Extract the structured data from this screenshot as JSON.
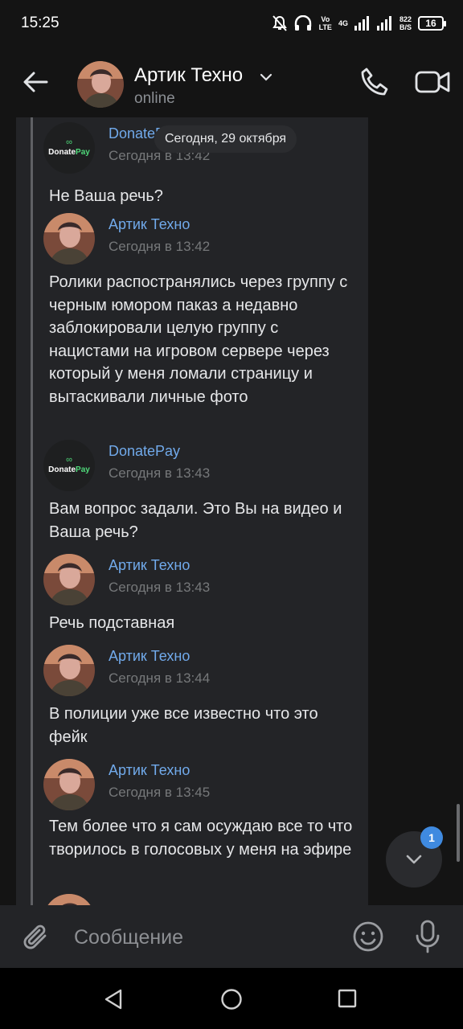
{
  "status_bar": {
    "time": "15:25",
    "volte": "Vo\nLTE",
    "network": "4G",
    "speed_value": "822",
    "speed_unit": "B/S",
    "battery": "16"
  },
  "header": {
    "contact_name": "Артик Техно",
    "contact_status": "online"
  },
  "date_divider": "Сегодня, 29 октября",
  "messages": [
    {
      "author": "DonatePay",
      "time": "Сегодня в 13:42",
      "text": "Не Ваша речь?",
      "avatar": "donatepay-logo"
    },
    {
      "author": "Артик Техно",
      "time": "Сегодня в 13:42",
      "text": "Ролики распостранялись через группу с черным юмором паказ а недавно заблокировали целую группу с нацистами на игровом сервере через который у меня ломали страницу и вытаскивали личные фото",
      "avatar": "user-photo"
    },
    {
      "author": "DonatePay",
      "time": "Сегодня в 13:43",
      "text": "Вам вопрос задали. Это Вы на видео и Ваша речь?",
      "avatar": "donatepay-logo"
    },
    {
      "author": "Артик Техно",
      "time": "Сегодня в 13:43",
      "text": "Речь подставная",
      "avatar": "user-photo"
    },
    {
      "author": "Артик Техно",
      "time": "Сегодня в 13:44",
      "text": "В полиции уже все известно что это фейк",
      "avatar": "user-photo"
    },
    {
      "author": "Артик Техно",
      "time": "Сегодня в 13:45",
      "text": "Тем более что я сам осуждаю все то что творилось в голосовых у меня на эфире",
      "avatar": "user-photo"
    }
  ],
  "donate_logo": {
    "text_a": "Donate",
    "text_b": "Pay"
  },
  "unread_count": "1",
  "composer": {
    "placeholder": "Сообщение"
  },
  "colors": {
    "author_link": "#71aaeb",
    "accent": "#3f8ae0",
    "donate_green": "#4fd97a"
  }
}
